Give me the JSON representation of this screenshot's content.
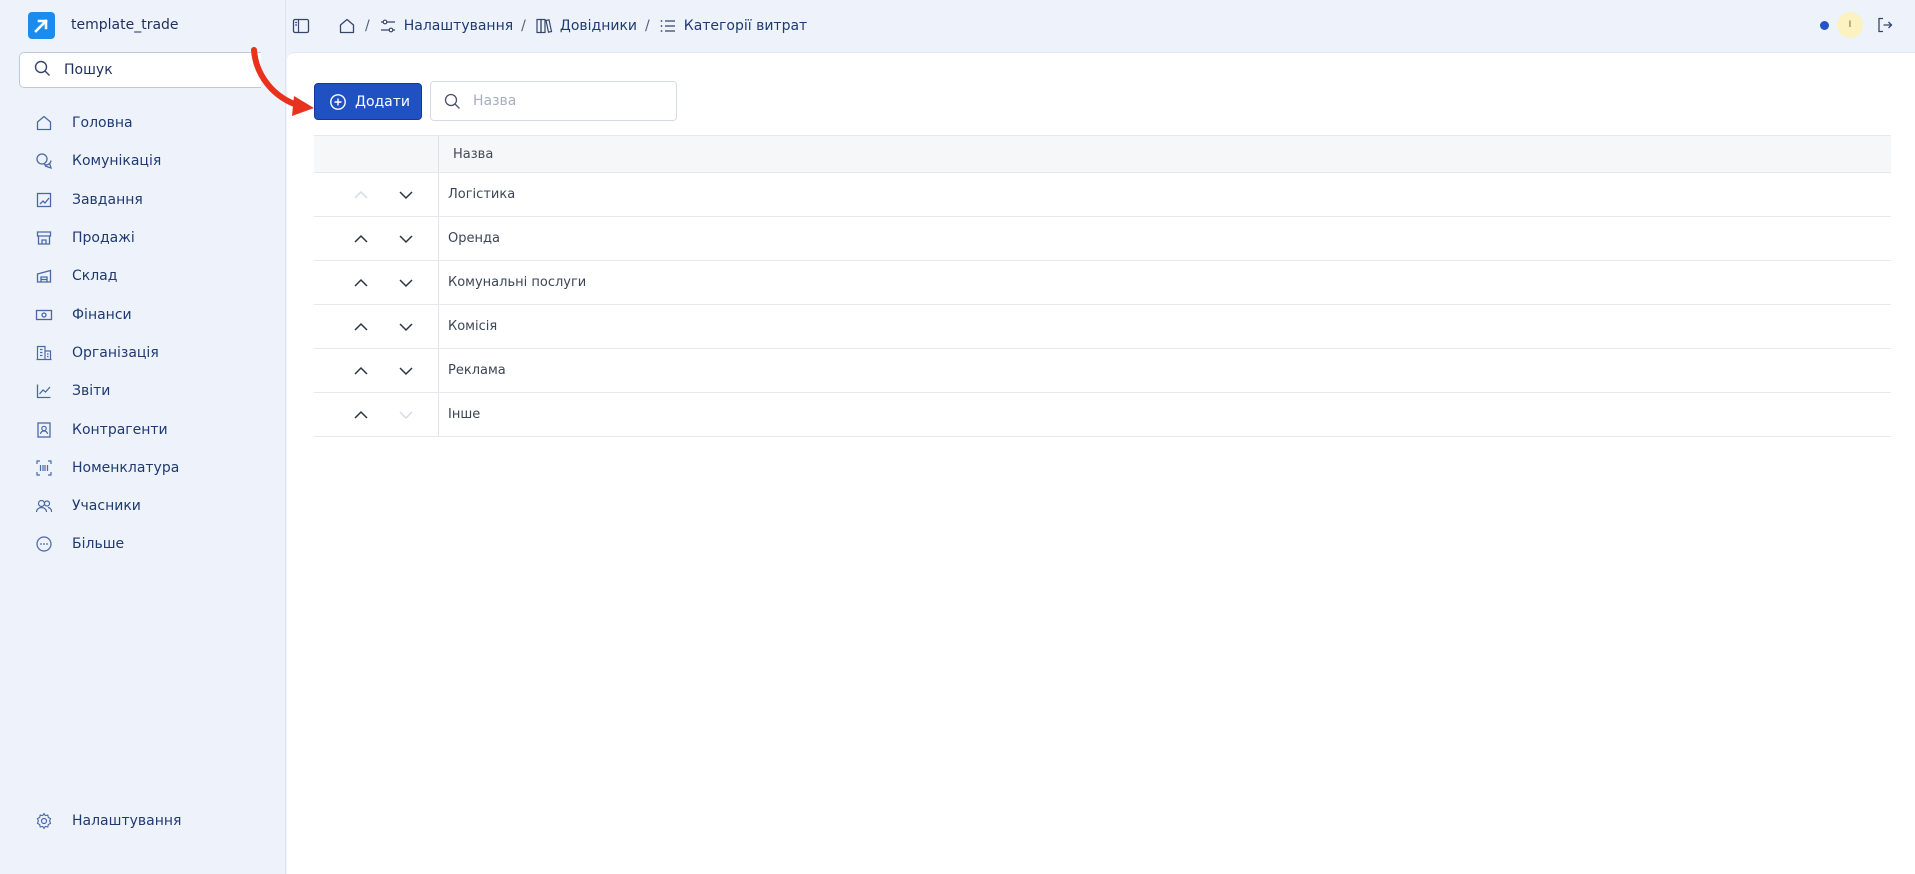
{
  "brand": {
    "name": "template_trade",
    "logo_color": "#1a8cf0"
  },
  "sidebar": {
    "search_label": "Пошук",
    "items": [
      {
        "label": "Головна",
        "icon": "home-icon"
      },
      {
        "label": "Комунікація",
        "icon": "chat-icon"
      },
      {
        "label": "Завдання",
        "icon": "tasks-icon"
      },
      {
        "label": "Продажі",
        "icon": "store-icon"
      },
      {
        "label": "Склад",
        "icon": "warehouse-icon"
      },
      {
        "label": "Фінанси",
        "icon": "money-icon"
      },
      {
        "label": "Організація",
        "icon": "building-icon"
      },
      {
        "label": "Звіти",
        "icon": "chart-icon"
      },
      {
        "label": "Контрагенти",
        "icon": "contact-icon"
      },
      {
        "label": "Номенклатура",
        "icon": "barcode-icon"
      },
      {
        "label": "Учасники",
        "icon": "users-icon"
      },
      {
        "label": "Більше",
        "icon": "more-icon"
      }
    ],
    "settings_label": "Налаштування"
  },
  "breadcrumb": {
    "items": [
      {
        "label": "Налаштування",
        "icon": "sliders-icon"
      },
      {
        "label": "Довідники",
        "icon": "books-icon"
      },
      {
        "label": "Категорії витрат",
        "icon": "list-icon"
      }
    ],
    "separator": "/"
  },
  "user": {
    "avatar_initial": "I",
    "status_color": "#2553c8"
  },
  "toolbar": {
    "add_label": "Додати",
    "search_placeholder": "Назва"
  },
  "table": {
    "column_name": "Назва",
    "rows": [
      {
        "name": "Логістика",
        "up_enabled": false,
        "down_enabled": true
      },
      {
        "name": "Оренда",
        "up_enabled": true,
        "down_enabled": true
      },
      {
        "name": "Комунальні послуги",
        "up_enabled": true,
        "down_enabled": true
      },
      {
        "name": "Комісія",
        "up_enabled": true,
        "down_enabled": true
      },
      {
        "name": "Реклама",
        "up_enabled": true,
        "down_enabled": true
      },
      {
        "name": "Інше",
        "up_enabled": true,
        "down_enabled": false
      }
    ]
  },
  "colors": {
    "accent": "#2051c2",
    "annotation": "#e8321e",
    "background": "#eef3fb"
  }
}
